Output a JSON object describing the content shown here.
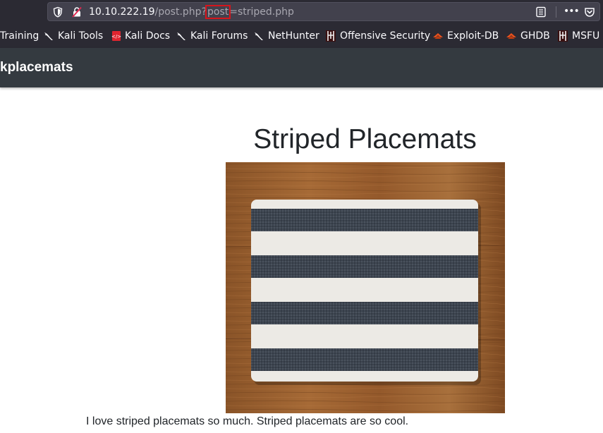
{
  "browser": {
    "url": {
      "host": "10.10.222.19",
      "path_before": "/post.php?",
      "highlighted": "post",
      "path_after": "=striped.php"
    },
    "icons": {
      "shield": "tracking-protection-icon",
      "lock": "insecure-connection-icon",
      "reader": "reader-view-icon",
      "more": "page-actions-icon",
      "pocket": "pocket-icon"
    },
    "more_label": "•••",
    "highlight_color": "#d6151c"
  },
  "bookmarks": [
    {
      "label": "Training",
      "icon": "none"
    },
    {
      "label": "Kali Tools",
      "icon": "kali-dragon-icon"
    },
    {
      "label": "Kali Docs",
      "icon": "kali-docs-icon"
    },
    {
      "label": "Kali Forums",
      "icon": "kali-dragon-icon"
    },
    {
      "label": "NetHunter",
      "icon": "kali-dragon-icon"
    },
    {
      "label": "Offensive Security",
      "icon": "offsec-icon"
    },
    {
      "label": "Exploit-DB",
      "icon": "exploitdb-icon"
    },
    {
      "label": "GHDB",
      "icon": "exploitdb-icon"
    },
    {
      "label": "MSFU",
      "icon": "offsec-icon"
    }
  ],
  "site": {
    "brand": "kplacemats",
    "nav_color": "#343a40"
  },
  "post": {
    "title": "Striped Placemats",
    "image": "striped-placemat-on-wood-photo",
    "body": "I love striped placemats so much. Striped placemats are so cool."
  }
}
